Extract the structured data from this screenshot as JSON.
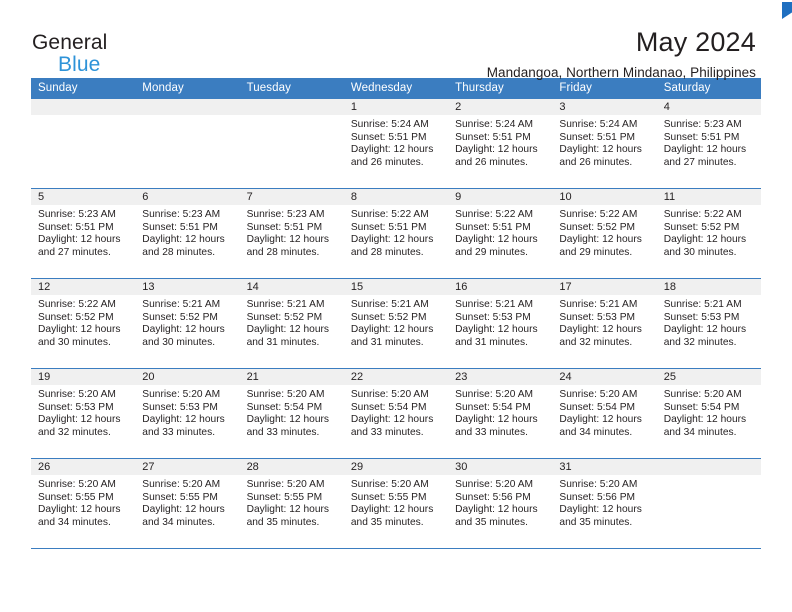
{
  "brand": {
    "line1": "General",
    "line2": "Blue",
    "logo_icon": "blue-triangle-icon"
  },
  "header": {
    "title": "May 2024",
    "subtitle": "Mandangoa, Northern Mindanao, Philippines"
  },
  "theme": {
    "header_blue": "#3b7dc0",
    "brand_blue": "#2e93d8",
    "logo_blue": "#1f6fc0",
    "day_band_gray": "#f0f0f0",
    "text": "#231f20"
  },
  "weekdays": [
    "Sunday",
    "Monday",
    "Tuesday",
    "Wednesday",
    "Thursday",
    "Friday",
    "Saturday"
  ],
  "weeks": [
    [
      {
        "day": "",
        "lines": []
      },
      {
        "day": "",
        "lines": []
      },
      {
        "day": "",
        "lines": []
      },
      {
        "day": "1",
        "lines": [
          "Sunrise: 5:24 AM",
          "Sunset: 5:51 PM",
          "Daylight: 12 hours",
          "and 26 minutes."
        ]
      },
      {
        "day": "2",
        "lines": [
          "Sunrise: 5:24 AM",
          "Sunset: 5:51 PM",
          "Daylight: 12 hours",
          "and 26 minutes."
        ]
      },
      {
        "day": "3",
        "lines": [
          "Sunrise: 5:24 AM",
          "Sunset: 5:51 PM",
          "Daylight: 12 hours",
          "and 26 minutes."
        ]
      },
      {
        "day": "4",
        "lines": [
          "Sunrise: 5:23 AM",
          "Sunset: 5:51 PM",
          "Daylight: 12 hours",
          "and 27 minutes."
        ]
      }
    ],
    [
      {
        "day": "5",
        "lines": [
          "Sunrise: 5:23 AM",
          "Sunset: 5:51 PM",
          "Daylight: 12 hours",
          "and 27 minutes."
        ]
      },
      {
        "day": "6",
        "lines": [
          "Sunrise: 5:23 AM",
          "Sunset: 5:51 PM",
          "Daylight: 12 hours",
          "and 28 minutes."
        ]
      },
      {
        "day": "7",
        "lines": [
          "Sunrise: 5:23 AM",
          "Sunset: 5:51 PM",
          "Daylight: 12 hours",
          "and 28 minutes."
        ]
      },
      {
        "day": "8",
        "lines": [
          "Sunrise: 5:22 AM",
          "Sunset: 5:51 PM",
          "Daylight: 12 hours",
          "and 28 minutes."
        ]
      },
      {
        "day": "9",
        "lines": [
          "Sunrise: 5:22 AM",
          "Sunset: 5:51 PM",
          "Daylight: 12 hours",
          "and 29 minutes."
        ]
      },
      {
        "day": "10",
        "lines": [
          "Sunrise: 5:22 AM",
          "Sunset: 5:52 PM",
          "Daylight: 12 hours",
          "and 29 minutes."
        ]
      },
      {
        "day": "11",
        "lines": [
          "Sunrise: 5:22 AM",
          "Sunset: 5:52 PM",
          "Daylight: 12 hours",
          "and 30 minutes."
        ]
      }
    ],
    [
      {
        "day": "12",
        "lines": [
          "Sunrise: 5:22 AM",
          "Sunset: 5:52 PM",
          "Daylight: 12 hours",
          "and 30 minutes."
        ]
      },
      {
        "day": "13",
        "lines": [
          "Sunrise: 5:21 AM",
          "Sunset: 5:52 PM",
          "Daylight: 12 hours",
          "and 30 minutes."
        ]
      },
      {
        "day": "14",
        "lines": [
          "Sunrise: 5:21 AM",
          "Sunset: 5:52 PM",
          "Daylight: 12 hours",
          "and 31 minutes."
        ]
      },
      {
        "day": "15",
        "lines": [
          "Sunrise: 5:21 AM",
          "Sunset: 5:52 PM",
          "Daylight: 12 hours",
          "and 31 minutes."
        ]
      },
      {
        "day": "16",
        "lines": [
          "Sunrise: 5:21 AM",
          "Sunset: 5:53 PM",
          "Daylight: 12 hours",
          "and 31 minutes."
        ]
      },
      {
        "day": "17",
        "lines": [
          "Sunrise: 5:21 AM",
          "Sunset: 5:53 PM",
          "Daylight: 12 hours",
          "and 32 minutes."
        ]
      },
      {
        "day": "18",
        "lines": [
          "Sunrise: 5:21 AM",
          "Sunset: 5:53 PM",
          "Daylight: 12 hours",
          "and 32 minutes."
        ]
      }
    ],
    [
      {
        "day": "19",
        "lines": [
          "Sunrise: 5:20 AM",
          "Sunset: 5:53 PM",
          "Daylight: 12 hours",
          "and 32 minutes."
        ]
      },
      {
        "day": "20",
        "lines": [
          "Sunrise: 5:20 AM",
          "Sunset: 5:53 PM",
          "Daylight: 12 hours",
          "and 33 minutes."
        ]
      },
      {
        "day": "21",
        "lines": [
          "Sunrise: 5:20 AM",
          "Sunset: 5:54 PM",
          "Daylight: 12 hours",
          "and 33 minutes."
        ]
      },
      {
        "day": "22",
        "lines": [
          "Sunrise: 5:20 AM",
          "Sunset: 5:54 PM",
          "Daylight: 12 hours",
          "and 33 minutes."
        ]
      },
      {
        "day": "23",
        "lines": [
          "Sunrise: 5:20 AM",
          "Sunset: 5:54 PM",
          "Daylight: 12 hours",
          "and 33 minutes."
        ]
      },
      {
        "day": "24",
        "lines": [
          "Sunrise: 5:20 AM",
          "Sunset: 5:54 PM",
          "Daylight: 12 hours",
          "and 34 minutes."
        ]
      },
      {
        "day": "25",
        "lines": [
          "Sunrise: 5:20 AM",
          "Sunset: 5:54 PM",
          "Daylight: 12 hours",
          "and 34 minutes."
        ]
      }
    ],
    [
      {
        "day": "26",
        "lines": [
          "Sunrise: 5:20 AM",
          "Sunset: 5:55 PM",
          "Daylight: 12 hours",
          "and 34 minutes."
        ]
      },
      {
        "day": "27",
        "lines": [
          "Sunrise: 5:20 AM",
          "Sunset: 5:55 PM",
          "Daylight: 12 hours",
          "and 34 minutes."
        ]
      },
      {
        "day": "28",
        "lines": [
          "Sunrise: 5:20 AM",
          "Sunset: 5:55 PM",
          "Daylight: 12 hours",
          "and 35 minutes."
        ]
      },
      {
        "day": "29",
        "lines": [
          "Sunrise: 5:20 AM",
          "Sunset: 5:55 PM",
          "Daylight: 12 hours",
          "and 35 minutes."
        ]
      },
      {
        "day": "30",
        "lines": [
          "Sunrise: 5:20 AM",
          "Sunset: 5:56 PM",
          "Daylight: 12 hours",
          "and 35 minutes."
        ]
      },
      {
        "day": "31",
        "lines": [
          "Sunrise: 5:20 AM",
          "Sunset: 5:56 PM",
          "Daylight: 12 hours",
          "and 35 minutes."
        ]
      },
      {
        "day": "",
        "lines": []
      }
    ]
  ]
}
